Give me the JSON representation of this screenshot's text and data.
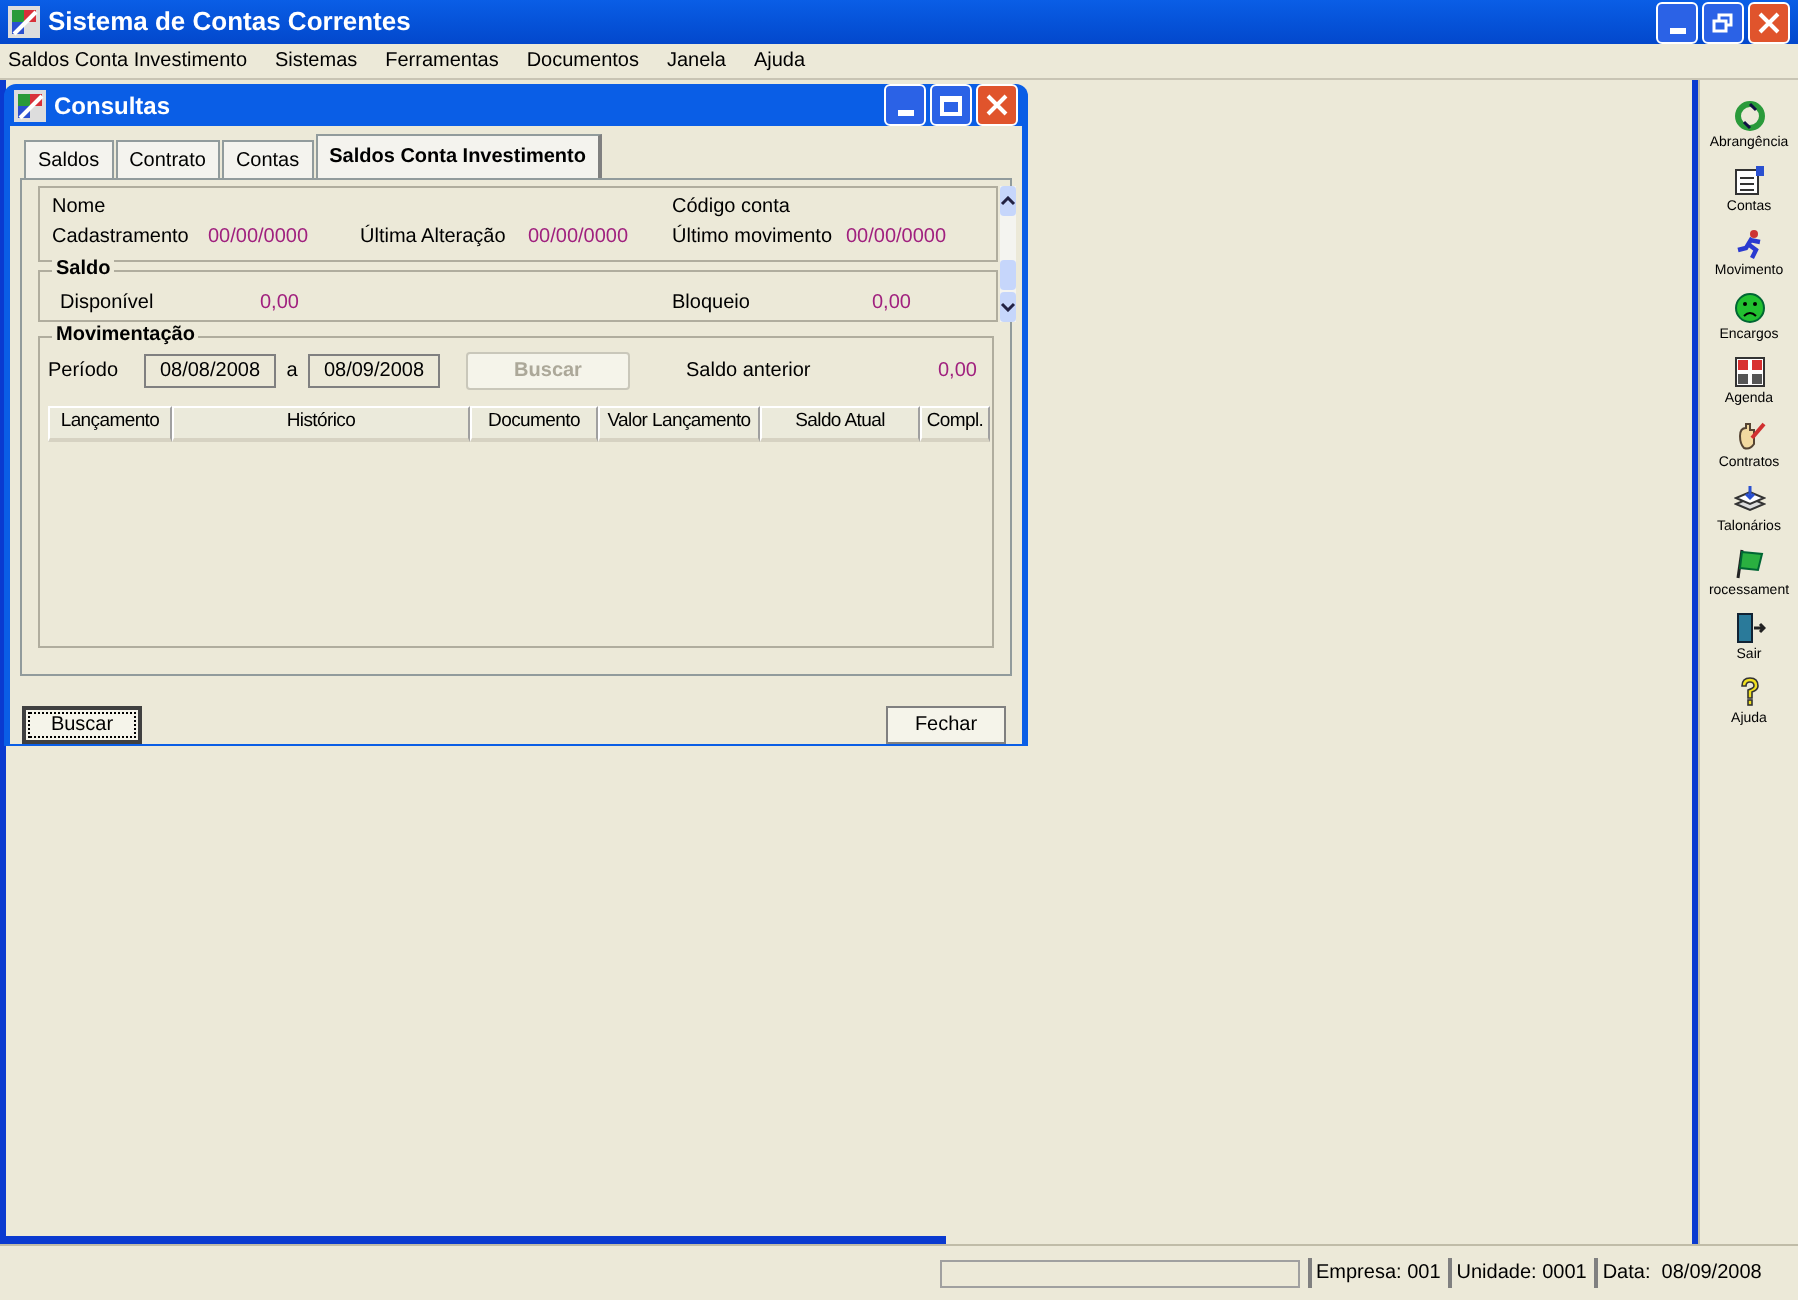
{
  "window": {
    "title": "Sistema de Contas Correntes"
  },
  "menu": [
    "Saldos Conta Investimento",
    "Sistemas",
    "Ferramentas",
    "Documentos",
    "Janela",
    "Ajuda"
  ],
  "child_window": {
    "title": "Consultas"
  },
  "tabs": [
    {
      "label": "Saldos",
      "selected": false
    },
    {
      "label": "Contrato",
      "selected": false
    },
    {
      "label": "Contas",
      "selected": false
    },
    {
      "label": "Saldos Conta Investimento",
      "selected": true
    }
  ],
  "account": {
    "name_label": "Nome",
    "code_label": "Código conta",
    "dates": [
      {
        "label": "Cadastramento",
        "value": "00/00/0000"
      },
      {
        "label": "Última Alteração",
        "value": "00/00/0000"
      },
      {
        "label": "Último movimento",
        "value": "00/00/0000"
      }
    ]
  },
  "saldo": {
    "title": "Saldo",
    "items": [
      {
        "label": "Disponível",
        "value": "0,00"
      },
      {
        "label": "Bloqueio",
        "value": "0,00"
      }
    ]
  },
  "movimentacao": {
    "title": "Movimentação",
    "period_label": "Período",
    "from": "08/08/2008",
    "separator": "a",
    "to": "08/09/2008",
    "search_button": {
      "label": "Buscar",
      "disabled": true
    },
    "previous_label": "Saldo anterior",
    "previous_value": "0,00",
    "columns": [
      "Lançamento",
      "Histórico",
      "Documento",
      "Valor Lançamento",
      "Saldo Atual",
      "Compl."
    ]
  },
  "buttons": [
    {
      "label": "Buscar",
      "focused": true
    },
    {
      "label": "Fechar",
      "focused": false
    }
  ],
  "toolbar": [
    {
      "label": "Abrangência",
      "kind": "recycle"
    },
    {
      "label": "Contas",
      "kind": "form"
    },
    {
      "label": "Movimento",
      "kind": "runner"
    },
    {
      "label": "Encargos",
      "kind": "face"
    },
    {
      "label": "Agenda",
      "kind": "calendar"
    },
    {
      "label": "Contratos",
      "kind": "hand"
    },
    {
      "label": "Talonários",
      "kind": "stack"
    },
    {
      "label": "rocessament",
      "kind": "flag"
    },
    {
      "label": "Sair",
      "kind": "door"
    },
    {
      "label": "Ajuda",
      "kind": "question"
    }
  ],
  "status_bar": [
    "Empresa: 001",
    "Unidade: 0001",
    "Data:  08/09/2008"
  ]
}
